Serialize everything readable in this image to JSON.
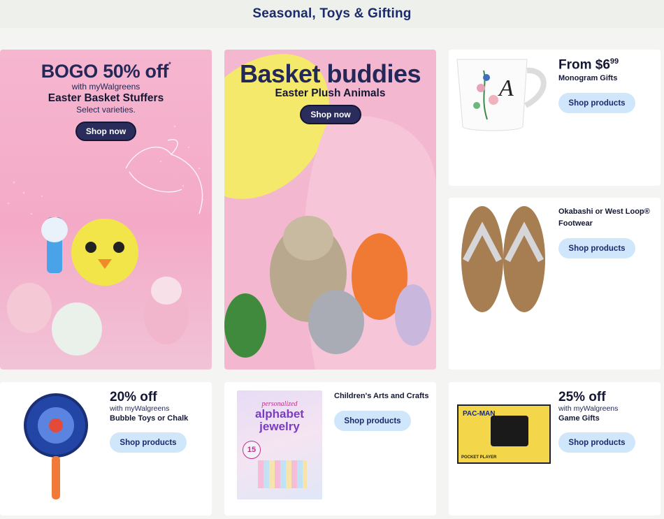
{
  "header": {
    "title": "Seasonal, Toys & Gifting"
  },
  "hero_easter_basket": {
    "headline": "BOGO 50% off",
    "asterisk": "*",
    "with": "with myWalgreens",
    "subtitle": "Easter Basket Stuffers",
    "note": "Select varieties.",
    "cta": "Shop now"
  },
  "hero_basket_buddies": {
    "headline": "Basket buddies",
    "subtitle": "Easter Plush Animals",
    "cta": "Shop now"
  },
  "monogram": {
    "price_prefix": "From ",
    "price_dollars": "$6",
    "price_cents": "99",
    "label": "Monogram Gifts",
    "cta": "Shop products",
    "mug_letter": "A"
  },
  "footwear": {
    "label": "Okabashi or West Loop® Footwear",
    "cta": "Shop products"
  },
  "bubbles": {
    "offer": "20% off",
    "with": "with myWalgreens",
    "label": "Bubble Toys or Chalk",
    "cta": "Shop products"
  },
  "crafts": {
    "label": "Children's Arts and Crafts",
    "cta": "Shop products",
    "box_line1": "personalized",
    "box_line2": "alphabet",
    "box_line3": "jewelry",
    "box_badge": "15"
  },
  "game_gifts": {
    "offer": "25% off",
    "with": "with myWalgreens",
    "label": "Game Gifts",
    "cta": "Shop products",
    "box_logo": "PAC-MAN",
    "box_caption": "POCKET PLAYER"
  },
  "colors": {
    "header_text": "#1b2a6b",
    "dark_button": "#2a2c5c",
    "light_button": "#cfe6fb",
    "hero_pink": "#f4aac7"
  }
}
